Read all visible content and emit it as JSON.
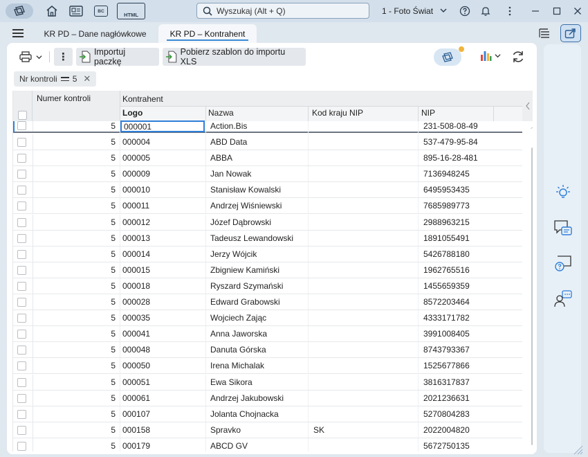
{
  "titlebar": {
    "icons": [
      "home-icon",
      "document-icon",
      "bc-icon",
      "html-icon"
    ],
    "bc_label": "BC",
    "html_label": "HTML",
    "search_placeholder": "Wyszukaj (Alt + Q)",
    "company": "1 - Foto Świat"
  },
  "tabs": [
    {
      "label": "KR PD – Dane nagłówkowe",
      "active": false
    },
    {
      "label": "KR PD – Kontrahent",
      "active": true
    }
  ],
  "toolbar": {
    "import_label": "Importuj paczkę",
    "template_label": "Pobierz szablon do importu XLS"
  },
  "filter": {
    "field": "Nr kontroli",
    "value": "5"
  },
  "grid": {
    "headers": {
      "numer_kontroli": "Numer kontroli",
      "kontrahent": "Kontrahent",
      "logo": "Logo",
      "nazwa": "Nazwa",
      "kod_kraju": "Kod kraju NIP",
      "nip": "NIP"
    },
    "rows": [
      {
        "num": "5",
        "logo": "000001",
        "name": "Action.Bis",
        "kod": "",
        "nip": "231-508-08-49"
      },
      {
        "num": "5",
        "logo": "000004",
        "name": "ABD Data",
        "kod": "",
        "nip": "537-479-95-84"
      },
      {
        "num": "5",
        "logo": "000005",
        "name": "ABBA",
        "kod": "",
        "nip": "895-16-28-481"
      },
      {
        "num": "5",
        "logo": "000009",
        "name": "Jan Nowak",
        "kod": "",
        "nip": "7136948245"
      },
      {
        "num": "5",
        "logo": "000010",
        "name": "Stanisław Kowalski",
        "kod": "",
        "nip": "6495953435"
      },
      {
        "num": "5",
        "logo": "000011",
        "name": "Andrzej Wiśniewski",
        "kod": "",
        "nip": "7685989773"
      },
      {
        "num": "5",
        "logo": "000012",
        "name": "Józef Dąbrowski",
        "kod": "",
        "nip": "2988963215"
      },
      {
        "num": "5",
        "logo": "000013",
        "name": "Tadeusz Lewandowski",
        "kod": "",
        "nip": "1891055491"
      },
      {
        "num": "5",
        "logo": "000014",
        "name": "Jerzy Wójcik",
        "kod": "",
        "nip": "5426788180"
      },
      {
        "num": "5",
        "logo": "000015",
        "name": "Zbigniew Kamiński",
        "kod": "",
        "nip": "1962765516"
      },
      {
        "num": "5",
        "logo": "000018",
        "name": "Ryszard Szymański",
        "kod": "",
        "nip": "1455659359"
      },
      {
        "num": "5",
        "logo": "000028",
        "name": "Edward Grabowski",
        "kod": "",
        "nip": "8572203464"
      },
      {
        "num": "5",
        "logo": "000035",
        "name": "Wojciech Zając",
        "kod": "",
        "nip": "4333171782"
      },
      {
        "num": "5",
        "logo": "000041",
        "name": "Anna Jaworska",
        "kod": "",
        "nip": "3991008405"
      },
      {
        "num": "5",
        "logo": "000048",
        "name": "Danuta Górska",
        "kod": "",
        "nip": "8743793367"
      },
      {
        "num": "5",
        "logo": "000050",
        "name": "Irena Michalak",
        "kod": "",
        "nip": "1525677866"
      },
      {
        "num": "5",
        "logo": "000051",
        "name": "Ewa Sikora",
        "kod": "",
        "nip": "3816317837"
      },
      {
        "num": "5",
        "logo": "000061",
        "name": "Andrzej Jakubowski",
        "kod": "",
        "nip": "2021236631"
      },
      {
        "num": "5",
        "logo": "000107",
        "name": "Jolanta Chojnacka",
        "kod": "",
        "nip": "5270804283"
      },
      {
        "num": "5",
        "logo": "000158",
        "name": "Spravko",
        "kod": "SK",
        "nip": "2022004820"
      },
      {
        "num": "5",
        "logo": "000179",
        "name": "ABCD GV",
        "kod": "",
        "nip": "5672750135"
      }
    ]
  },
  "sidepanel": {
    "icons": [
      "lightbulb-icon",
      "chat-icon",
      "help-chat-icon",
      "support-icon"
    ]
  },
  "colors": {
    "accent": "#2f7ed8",
    "titlebar_bg": "#d3dfea",
    "page_bg": "#dfe7ef"
  }
}
